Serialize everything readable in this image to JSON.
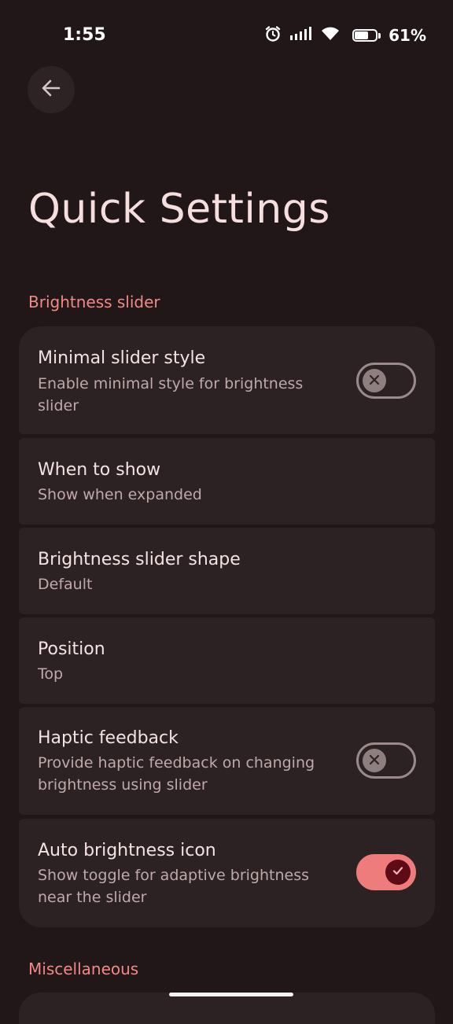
{
  "status_bar": {
    "time": "1:55",
    "battery_percent": "61%",
    "battery_level": 0.61,
    "icons": [
      "alarm-icon",
      "signal-icon",
      "wifi-icon",
      "battery-icon"
    ]
  },
  "header": {
    "back_icon": "arrow-left-icon",
    "title": "Quick Settings"
  },
  "sections": [
    {
      "title": "Brightness slider",
      "items": [
        {
          "title": "Minimal slider style",
          "subtitle": "Enable minimal style for brightness slider",
          "toggle": false
        },
        {
          "title": "When to show",
          "subtitle": "Show when expanded"
        },
        {
          "title": "Brightness slider shape",
          "subtitle": "Default"
        },
        {
          "title": "Position",
          "subtitle": "Top"
        },
        {
          "title": "Haptic feedback",
          "subtitle": "Provide haptic feedback on changing brightness using slider",
          "toggle": false
        },
        {
          "title": "Auto brightness icon",
          "subtitle": "Show toggle for adaptive brightness near the slider",
          "toggle": true
        }
      ]
    },
    {
      "title": "Miscellaneous",
      "items": []
    }
  ],
  "colors": {
    "background": "#211719",
    "card": "#2c2123",
    "accent": "#ef7c7c",
    "section_title": "#f08a84"
  }
}
